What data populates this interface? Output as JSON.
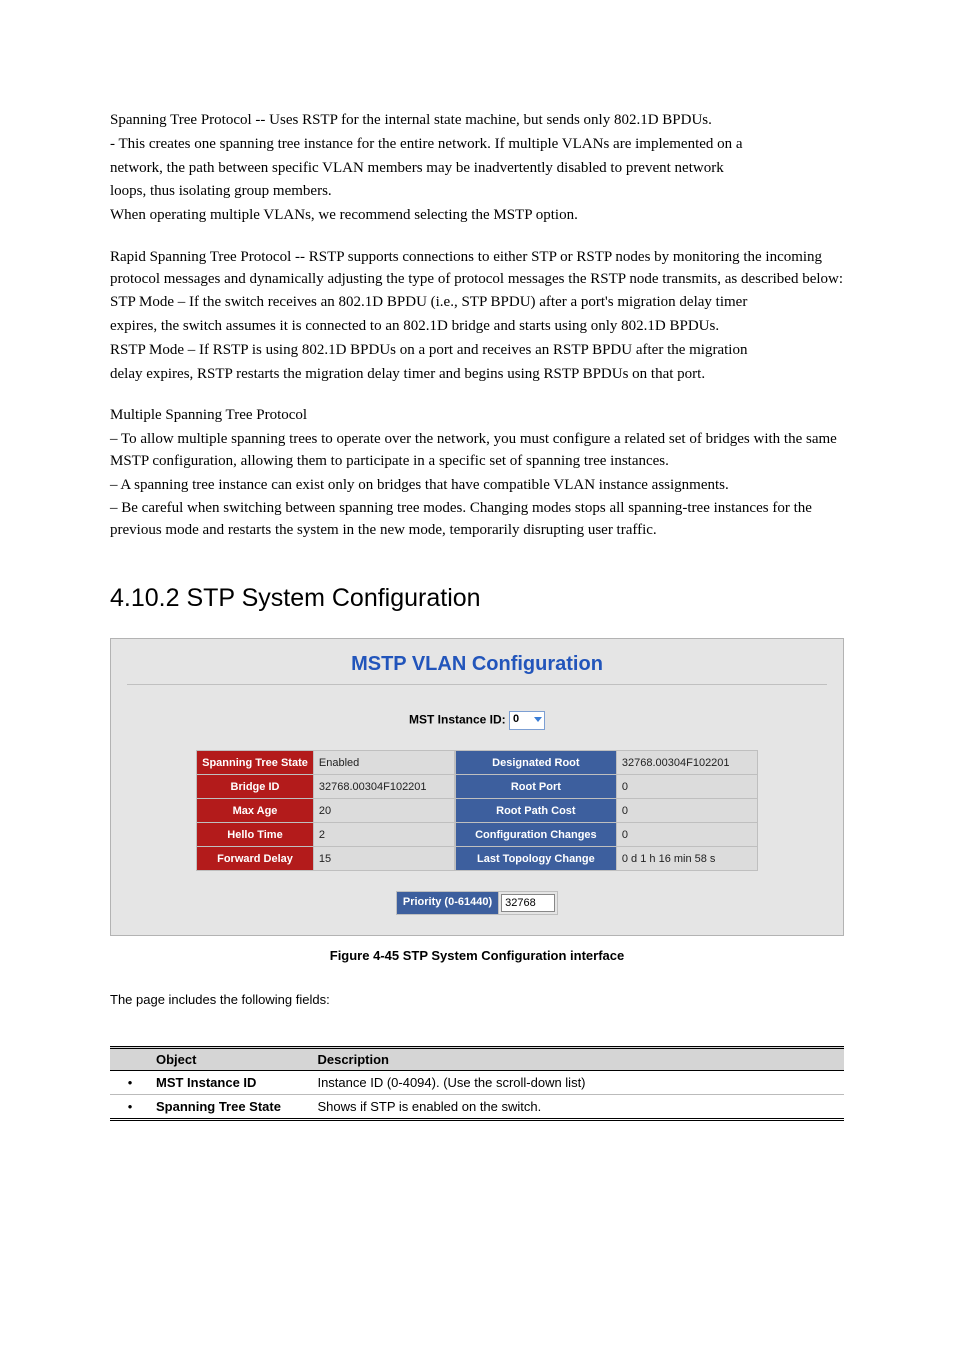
{
  "body": {
    "p1": "Spanning Tree Protocol -- Uses RSTP for the internal state machine, but sends only 802.1D BPDUs.",
    "p2_a": "- This creates one spanning tree instance for the entire network. If multiple VLANs are implemented on a",
    "p2_b": "network, the path between specific VLAN members may be inadvertently disabled to prevent network",
    "p2_c": "loops, thus isolating group members.",
    "p2_d": "When operating multiple VLANs, we recommend selecting the MSTP option.",
    "p3": "Rapid Spanning Tree Protocol -- RSTP supports connections to either STP or RSTP nodes by monitoring the incoming protocol messages and dynamically adjusting the type of protocol messages the RSTP node transmits, as described below:",
    "p4_a": "STP Mode – If the switch receives an 802.1D BPDU (i.e., STP BPDU) after a port's migration delay timer",
    "p4_b": "expires, the switch assumes it is connected to an 802.1D bridge and starts using only 802.1D BPDUs.",
    "p5_a": "RSTP Mode – If RSTP is using 802.1D BPDUs on a port and receives an RSTP BPDU after the migration",
    "p5_b": "delay expires, RSTP restarts the migration delay timer and begins using RSTP BPDUs on that port.",
    "p6": "Multiple Spanning Tree Protocol",
    "p7": "– To allow multiple spanning trees to operate over the network, you must configure a related set of bridges with the same MSTP configuration, allowing them to participate in a specific set of spanning tree instances.",
    "p8": "– A spanning tree instance can exist only on bridges that have compatible VLAN instance assignments.",
    "p9": "– Be careful when switching between spanning tree modes. Changing modes stops all spanning-tree instances for the previous mode and restarts the system in the new mode, temporarily disrupting user traffic."
  },
  "heading": "4.10.2 STP System Configuration",
  "panel": {
    "title": "MSTP VLAN Configuration",
    "instance_label": "MST Instance ID:",
    "instance_value": "0",
    "left": {
      "r1_label": "Spanning Tree State",
      "r1_val": "Enabled",
      "r2_label": "Bridge ID",
      "r2_val": "32768.00304F102201",
      "r3_label": "Max Age",
      "r3_val": "20",
      "r4_label": "Hello Time",
      "r4_val": "2",
      "r5_label": "Forward Delay",
      "r5_val": "15"
    },
    "right": {
      "r1_label": "Designated Root",
      "r1_val": "32768.00304F102201",
      "r2_label": "Root Port",
      "r2_val": "0",
      "r3_label": "Root Path Cost",
      "r3_val": "0",
      "r4_label": "Configuration Changes",
      "r4_val": "0",
      "r5_label": "Last Topology Change",
      "r5_val": "0 d 1 h 16 min 58 s"
    },
    "priority_label": "Priority (0-61440)",
    "priority_value": "32768"
  },
  "figure_caption": "Figure 4-45 STP System Configuration interface",
  "param_section": {
    "intro": "The page includes the following fields:",
    "header_obj": "Object",
    "header_desc": "Description",
    "rows": [
      {
        "obj": "MST Instance ID",
        "desc": "Instance ID (0-4094). (Use the scroll-down list)"
      },
      {
        "obj": "Spanning Tree State",
        "desc": "Shows if STP is enabled on the switch."
      }
    ]
  },
  "chart_data": {
    "type": "table",
    "title": "MSTP VLAN Configuration",
    "series": [
      {
        "name": "Spanning Tree State",
        "values": [
          "Enabled"
        ]
      },
      {
        "name": "Bridge ID",
        "values": [
          "32768.00304F102201"
        ]
      },
      {
        "name": "Max Age",
        "values": [
          20
        ]
      },
      {
        "name": "Hello Time",
        "values": [
          2
        ]
      },
      {
        "name": "Forward Delay",
        "values": [
          15
        ]
      },
      {
        "name": "Designated Root",
        "values": [
          "32768.00304F102201"
        ]
      },
      {
        "name": "Root Port",
        "values": [
          0
        ]
      },
      {
        "name": "Root Path Cost",
        "values": [
          0
        ]
      },
      {
        "name": "Configuration Changes",
        "values": [
          0
        ]
      },
      {
        "name": "Last Topology Change",
        "values": [
          "0 d 1 h 16 min 58 s"
        ]
      },
      {
        "name": "Priority (0-61440)",
        "values": [
          32768
        ]
      },
      {
        "name": "MST Instance ID",
        "values": [
          0
        ]
      }
    ]
  }
}
